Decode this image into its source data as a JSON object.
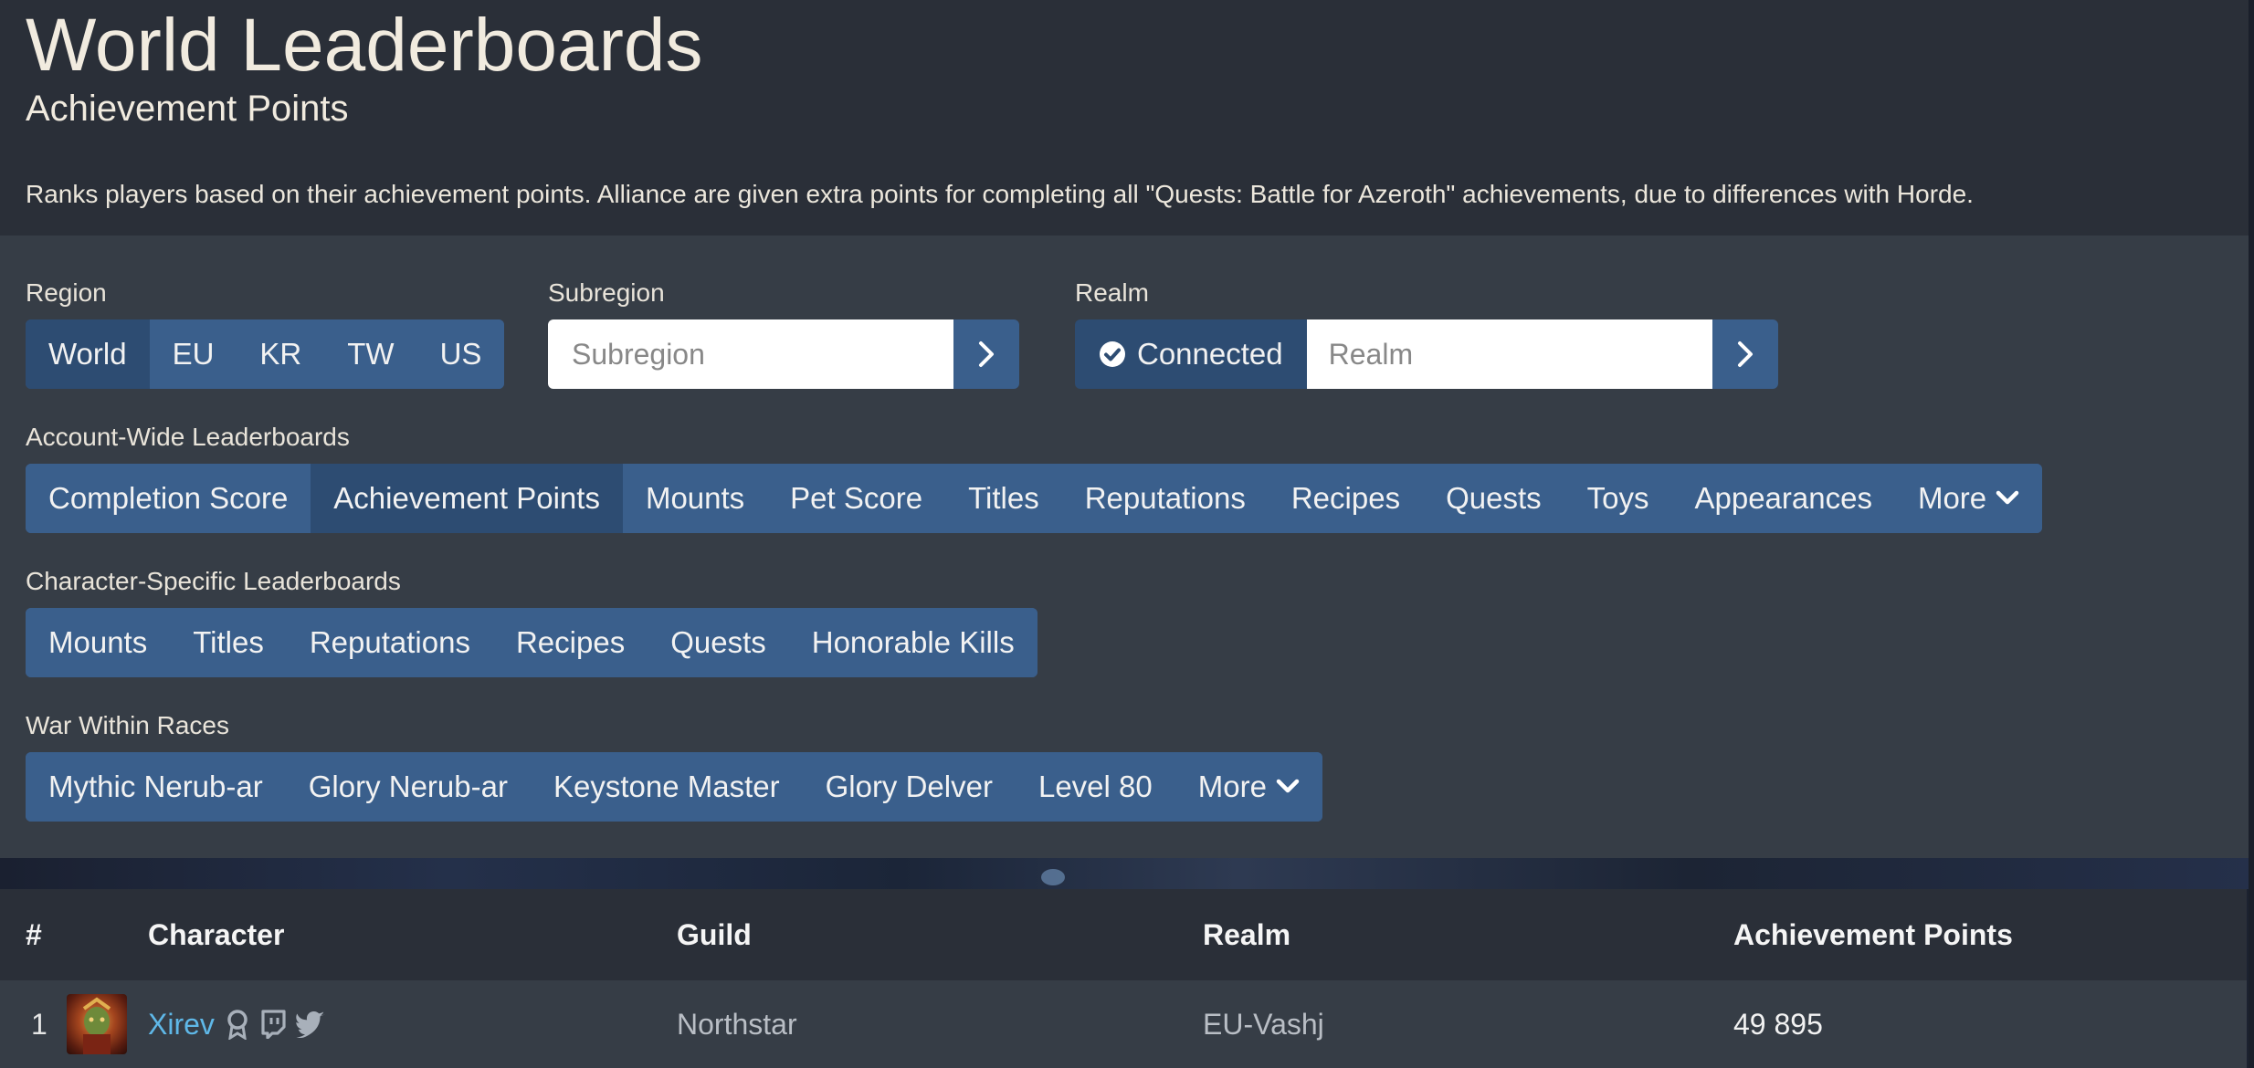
{
  "header": {
    "title": "World Leaderboards",
    "subtitle": "Achievement Points",
    "description": "Ranks players based on their achievement points. Alliance are given extra points for completing all \"Quests: Battle for Azeroth\" achievements, due to differences with Horde."
  },
  "region": {
    "label": "Region",
    "options": [
      "World",
      "EU",
      "KR",
      "TW",
      "US"
    ],
    "selected": "World"
  },
  "subregion": {
    "label": "Subregion",
    "placeholder": "Subregion"
  },
  "realm": {
    "label": "Realm",
    "connected_label": "Connected",
    "placeholder": "Realm"
  },
  "account_wide": {
    "label": "Account-Wide Leaderboards",
    "items": [
      "Completion Score",
      "Achievement Points",
      "Mounts",
      "Pet Score",
      "Titles",
      "Reputations",
      "Recipes",
      "Quests",
      "Toys",
      "Appearances",
      "More"
    ],
    "selected": "Achievement Points"
  },
  "character_specific": {
    "label": "Character-Specific Leaderboards",
    "items": [
      "Mounts",
      "Titles",
      "Reputations",
      "Recipes",
      "Quests",
      "Honorable Kills"
    ]
  },
  "war_within": {
    "label": "War Within Races",
    "items": [
      "Mythic Nerub-ar",
      "Glory Nerub-ar",
      "Keystone Master",
      "Glory Delver",
      "Level 80",
      "More"
    ]
  },
  "table": {
    "columns": [
      "#",
      "Character",
      "Guild",
      "Realm",
      "Achievement Points"
    ],
    "rows": [
      {
        "rank": "1",
        "character": "Xirev",
        "guild": "Northstar",
        "realm": "EU-Vashj",
        "points": "49 895"
      }
    ]
  },
  "colors": {
    "accent_button": "#3a5f8c",
    "active_button": "#2d4c72",
    "link": "#5fb8e8"
  }
}
